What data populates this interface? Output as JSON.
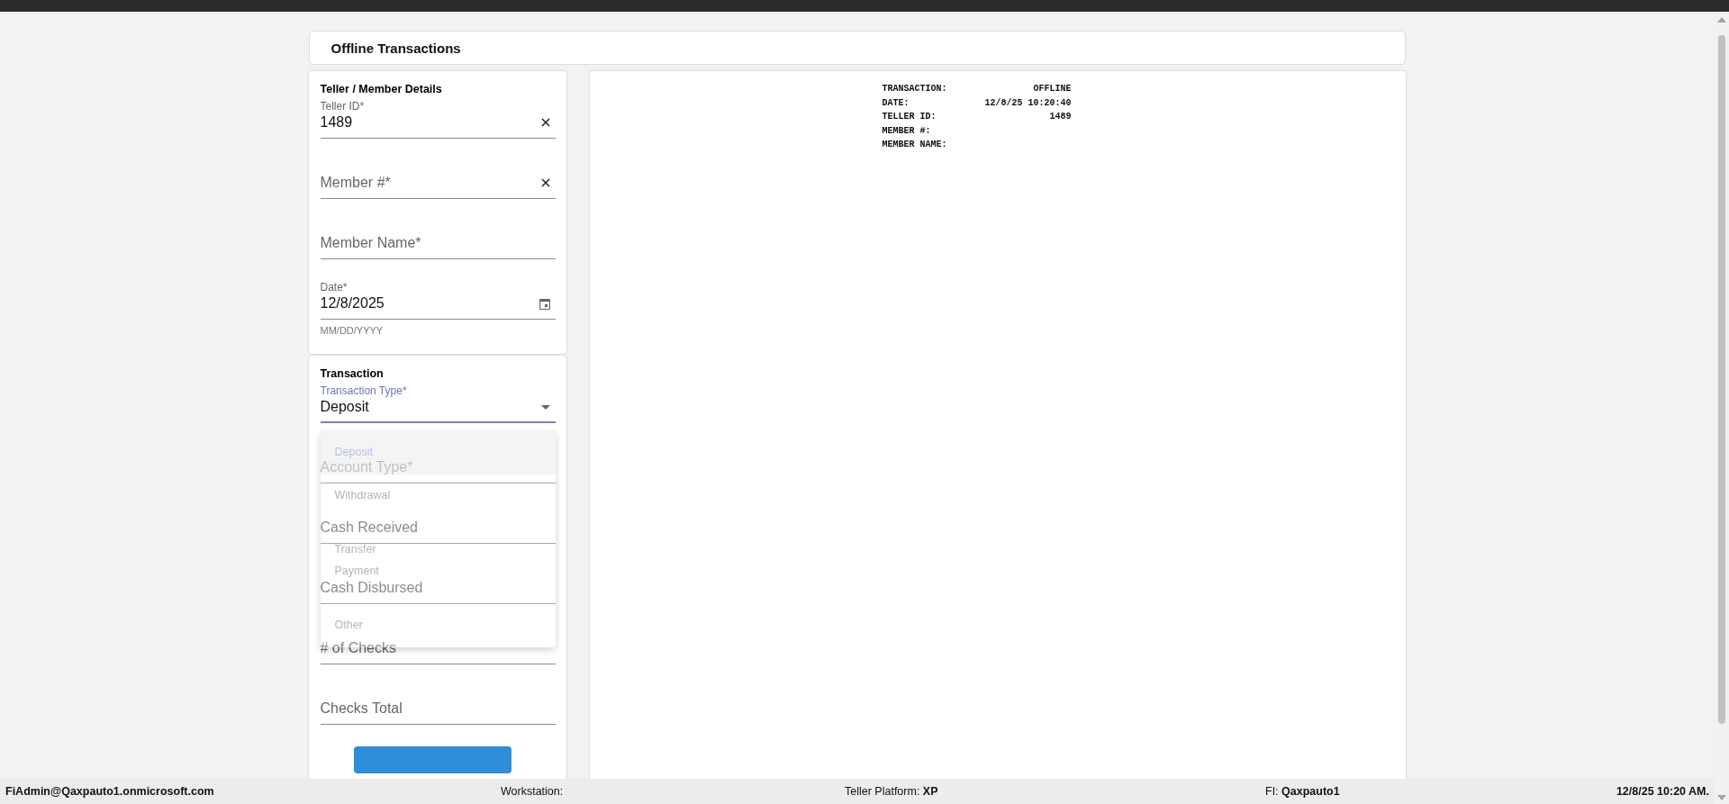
{
  "page_title": "Offline Transactions",
  "teller_member_details": {
    "title": "Teller / Member Details",
    "fields": [
      {
        "kind": "text",
        "label": "Teller ID*",
        "value": "1489",
        "clearable": true,
        "focused": false
      },
      {
        "kind": "text",
        "label": "Member #*",
        "clearable": true,
        "focused": false
      },
      {
        "kind": "text",
        "label": "Member Name*",
        "clearable": false,
        "focused": false
      },
      {
        "kind": "date",
        "label": "Date*",
        "value": "12/8/2025",
        "helper": "MM/DD/YYYY",
        "clearable": false,
        "focused": false
      }
    ]
  },
  "transaction": {
    "title": "Transaction",
    "fields": [
      {
        "kind": "select",
        "label": "Transaction Type*",
        "value": "Deposit",
        "clearable": false,
        "focused": true
      },
      {
        "kind": "text",
        "label": "Account Type*",
        "clearable": false,
        "focused": false
      },
      {
        "kind": "text",
        "label": "Cash Received",
        "clearable": false,
        "focused": false
      },
      {
        "kind": "text",
        "label": "Cash Disbursed",
        "clearable": false,
        "focused": false
      },
      {
        "kind": "text",
        "label": "# of Checks",
        "clearable": false,
        "focused": false
      },
      {
        "kind": "text",
        "label": "Checks Total",
        "clearable": false,
        "focused": false
      }
    ],
    "dropdown_options": [
      {
        "label": "Deposit",
        "selected": true
      },
      {
        "label": "Withdrawal",
        "selected": false
      },
      {
        "label": "Transfer",
        "selected": false
      },
      {
        "label": "Payment",
        "selected": false
      },
      {
        "label": "Other",
        "selected": false
      }
    ]
  },
  "receipt": {
    "lines": [
      {
        "label": "TRANSACTION:",
        "value": "OFFLINE"
      },
      {
        "label": "DATE:",
        "value": "12/8/25 10:20:40"
      },
      {
        "label": "TELLER ID:",
        "value": "1489"
      },
      {
        "label": "MEMBER #:"
      },
      {
        "label": "MEMBER NAME:"
      }
    ]
  },
  "status_bar": {
    "user": "FiAdmin@Qaxpauto1.onmicrosoft.com",
    "workstation_label": "Workstation:",
    "platform_label": "Teller Platform:",
    "platform": "XP",
    "fi_label": "FI:",
    "fi": "Qaxpauto1",
    "datetime": "12/8/25 10:20 AM."
  }
}
